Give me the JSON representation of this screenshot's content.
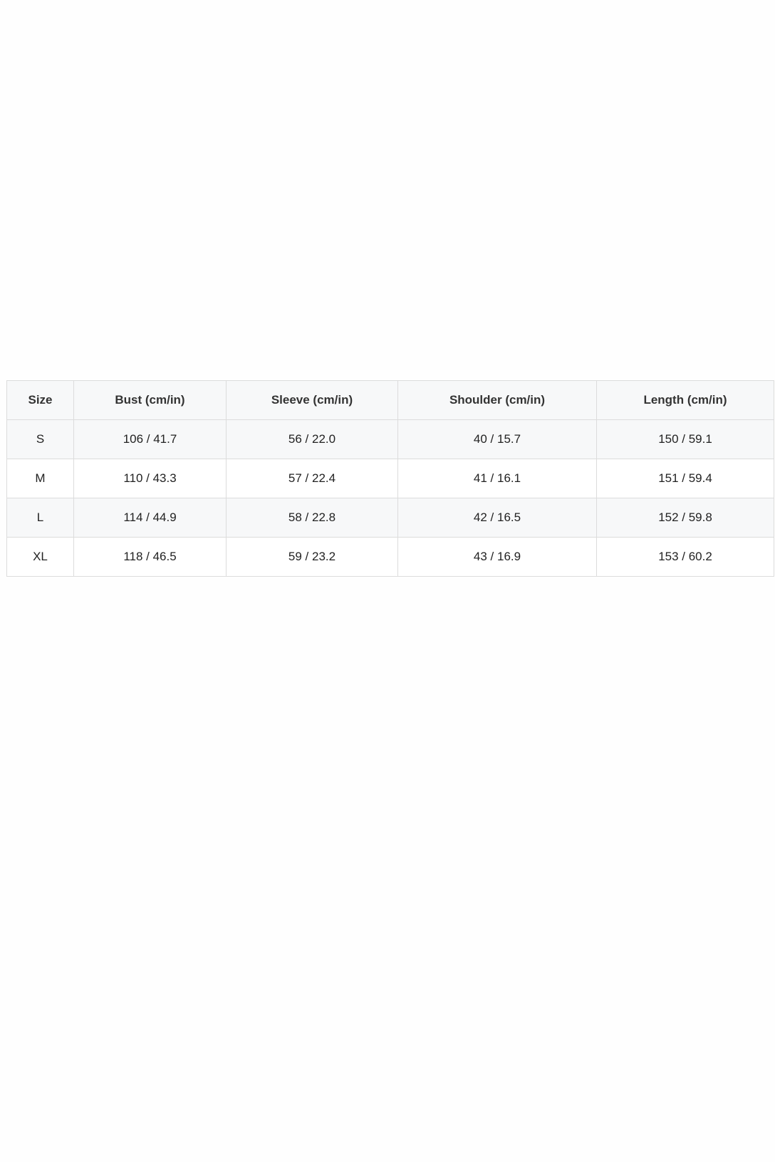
{
  "size_chart": {
    "headers": [
      "Size",
      "Bust (cm/in)",
      "Sleeve (cm/in)",
      "Shoulder (cm/in)",
      "Length (cm/in)"
    ],
    "rows": [
      [
        "S",
        "106 / 41.7",
        "56 / 22.0",
        "40 / 15.7",
        "150 / 59.1"
      ],
      [
        "M",
        "110 / 43.3",
        "57 / 22.4",
        "41 / 16.1",
        "151 / 59.4"
      ],
      [
        "L",
        "114 / 44.9",
        "58 / 22.8",
        "42 / 16.5",
        "152 / 59.8"
      ],
      [
        "XL",
        "118 / 46.5",
        "59 / 23.2",
        "43 / 16.9",
        "153 / 60.2"
      ]
    ]
  }
}
